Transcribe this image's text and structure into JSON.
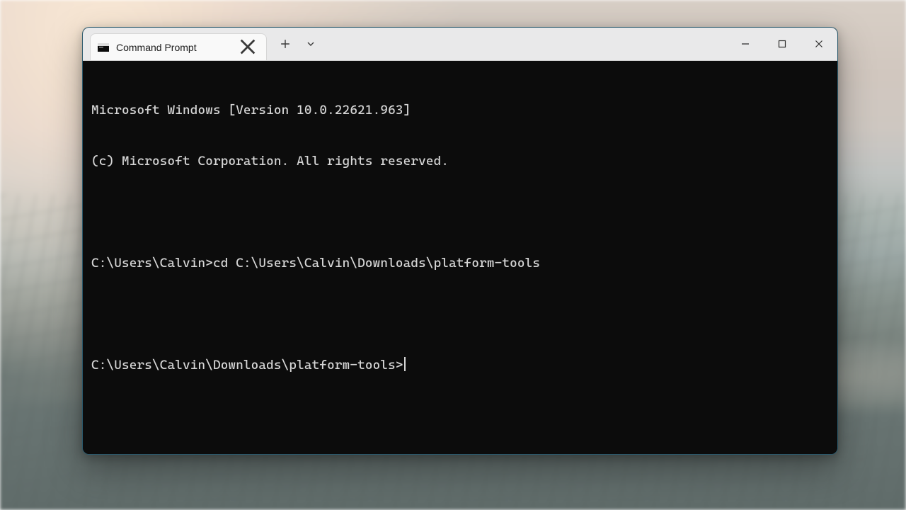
{
  "tab": {
    "title": "Command Prompt"
  },
  "terminal": {
    "banner_line1": "Microsoft Windows [Version 10.0.22621.963]",
    "banner_line2": "(c) Microsoft Corporation. All rights reserved.",
    "prompt1": "C:\\Users\\Calvin>",
    "command1": "cd C:\\Users\\Calvin\\Downloads\\platform-tools",
    "prompt2": "C:\\Users\\Calvin\\Downloads\\platform-tools>"
  }
}
